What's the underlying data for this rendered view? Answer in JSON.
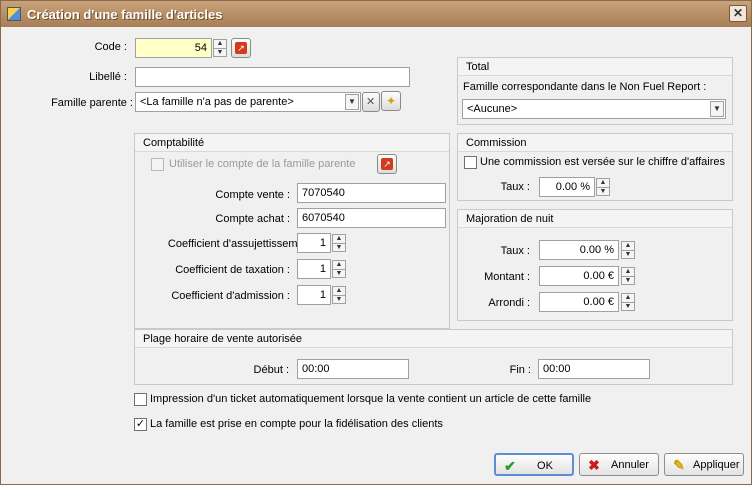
{
  "window": {
    "title": "Création d'une famille d'articles",
    "close_glyph": "✕"
  },
  "main": {
    "code_label": "Code :",
    "code_value": "54",
    "libelle_label": "Libellé :",
    "libelle_value": "",
    "famille_parente_label": "Famille parente :",
    "famille_parente_value": "<La famille n'a pas de parente>"
  },
  "total": {
    "title": "Total",
    "label": "Famille correspondante dans le Non Fuel Report :",
    "value": "<Aucune>"
  },
  "comptabilite": {
    "title": "Comptabilité",
    "use_parent_label": "Utiliser le compte de la famille parente",
    "use_parent_checked": false,
    "compte_vente_label": "Compte vente :",
    "compte_vente_value": "7070540",
    "compte_achat_label": "Compte achat :",
    "compte_achat_value": "6070540",
    "coef_assujettissement_label": "Coefficient d'assujettissement :",
    "coef_assujettissement_value": "1",
    "coef_taxation_label": "Coefficient de taxation :",
    "coef_taxation_value": "1",
    "coef_admission_label": "Coefficient d'admission :",
    "coef_admission_value": "1"
  },
  "commission": {
    "title": "Commission",
    "checkbox_label": "Une commission est versée sur le chiffre d'affaires",
    "checked": false,
    "taux_label": "Taux :",
    "taux_value": "0.00 %"
  },
  "majoration": {
    "title": "Majoration de nuit",
    "taux_label": "Taux :",
    "taux_value": "0.00 %",
    "montant_label": "Montant :",
    "montant_value": "0.00 €",
    "arrondi_label": "Arrondi :",
    "arrondi_value": "0.00 €"
  },
  "plage": {
    "title": "Plage horaire de vente autorisée",
    "debut_label": "Début :",
    "debut_value": "00:00",
    "fin_label": "Fin :",
    "fin_value": "00:00"
  },
  "options": {
    "impression_label": "Impression d'un ticket automatiquement lorsque la vente contient un article de cette famille",
    "impression_checked": false,
    "fidelisation_label": "La famille est prise en compte pour la fidélisation des clients",
    "fidelisation_checked": true,
    "check_glyph": "✓"
  },
  "buttons": {
    "ok_label": "OK",
    "annuler_label": "Annuler",
    "appliquer_label": "Appliquer",
    "ok_icon": "✔",
    "annuler_icon": "✖",
    "appliquer_icon": "✎"
  },
  "glyphs": {
    "spin_up": "▲",
    "spin_down": "▼",
    "dropdown": "▼",
    "clear": "✕",
    "wand": "✦",
    "pin": "↗"
  },
  "colors": {
    "title_bar": "#b08a62",
    "accent_red": "#d23a1e",
    "ok_green": "#2a9a2a",
    "cancel_red": "#c81e1e"
  }
}
